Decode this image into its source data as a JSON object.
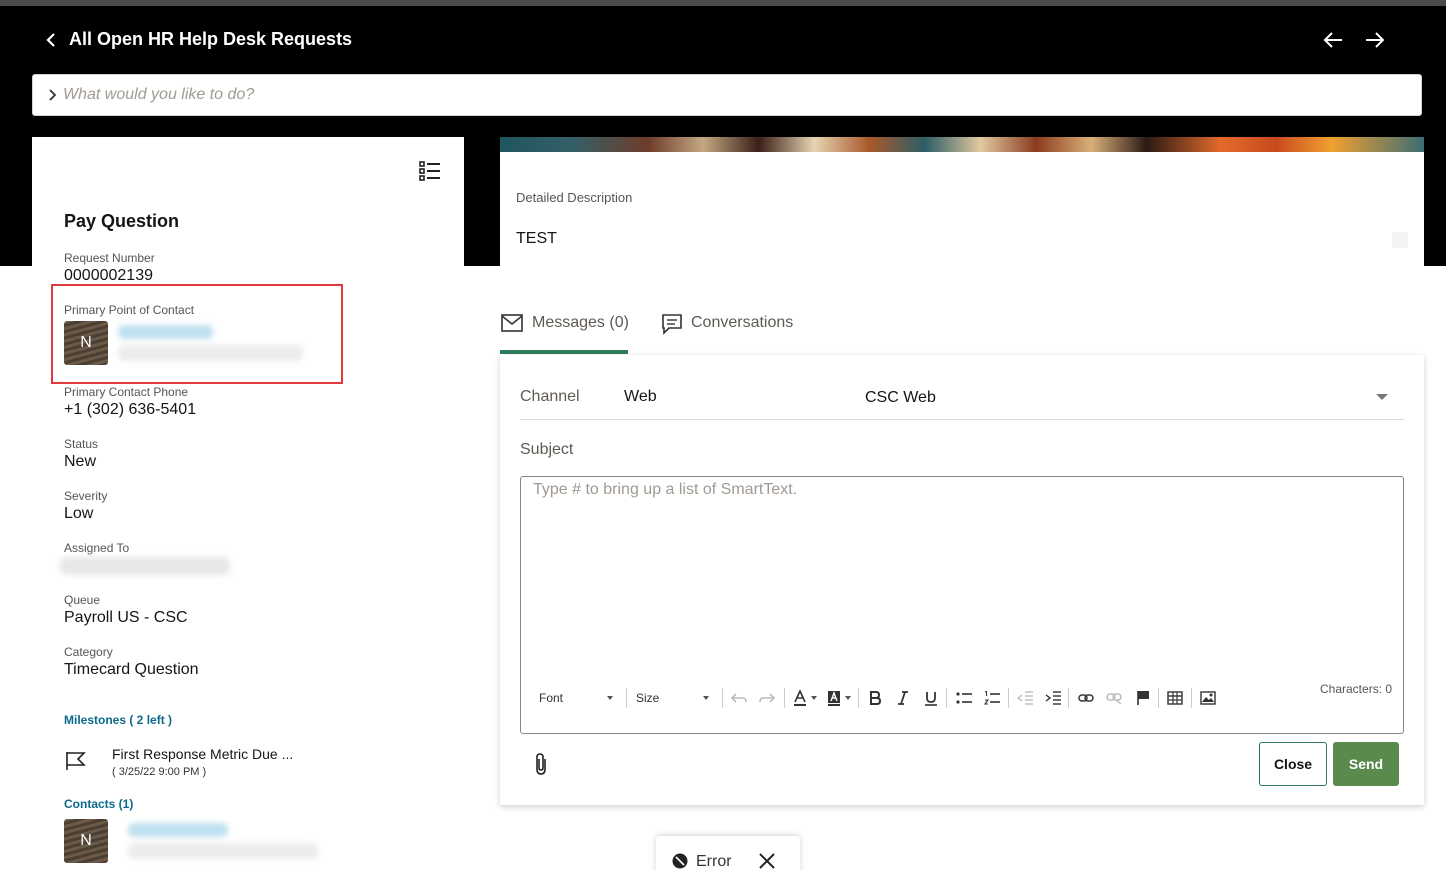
{
  "header": {
    "title": "All Open HR Help Desk Requests"
  },
  "search": {
    "placeholder": "What would you like to do?"
  },
  "request": {
    "title": "Pay Question",
    "fields": {
      "request_number_label": "Request Number",
      "request_number": "0000002139",
      "poc_label": "Primary Point of Contact",
      "poc_initial": "N",
      "phone_label": "Primary Contact Phone",
      "phone": "+1 (302) 636-5401",
      "status_label": "Status",
      "status": "New",
      "severity_label": "Severity",
      "severity": "Low",
      "assigned_label": "Assigned To",
      "queue_label": "Queue",
      "queue": "Payroll US - CSC",
      "category_label": "Category",
      "category": "Timecard Question"
    },
    "milestones_label": "Milestones ( 2 left )",
    "milestone": {
      "name": "First Response Metric Due ...",
      "date": "( 3/25/22 9:00 PM )"
    },
    "contacts_label": "Contacts (1)",
    "contact_initial": "N"
  },
  "description": {
    "label": "Detailed Description",
    "value": "TEST"
  },
  "tabs": [
    {
      "label": "Messages (0)",
      "icon": "envelope-icon",
      "active": true
    },
    {
      "label": "Conversations",
      "icon": "chat-icon",
      "active": false
    }
  ],
  "compose": {
    "channel_label": "Channel",
    "channel_value": "Web",
    "channel_option": "CSC Web",
    "subject_label": "Subject",
    "body_placeholder": "Type # to bring up a list of SmartText.",
    "toolbar": {
      "font": "Font",
      "size": "Size"
    },
    "characters": "Characters: 0",
    "close_label": "Close",
    "send_label": "Send"
  },
  "toast": {
    "text": "Error"
  },
  "colors": {
    "accent_green": "#2c7c5a",
    "send_green": "#5a8a4c",
    "link_teal": "#0b6a8a",
    "highlight_red": "#e03a3e"
  }
}
